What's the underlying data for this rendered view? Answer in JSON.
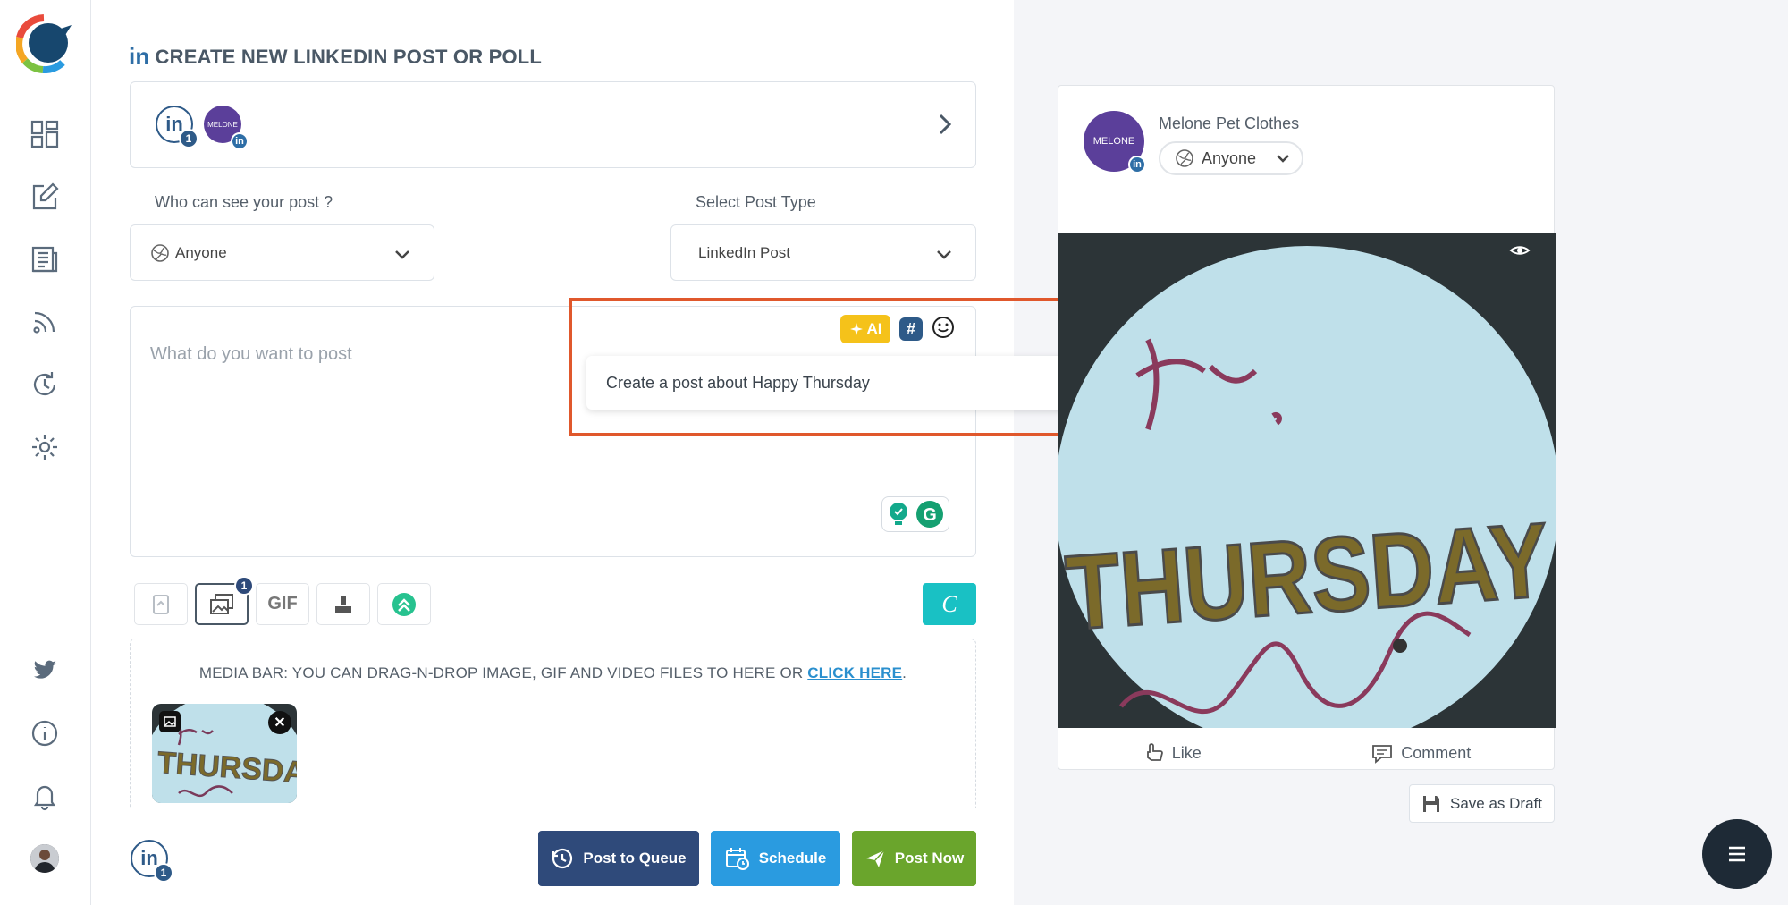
{
  "page": {
    "title": "CREATE NEW LINKEDIN POST OR POLL",
    "title_icon": "in"
  },
  "accounts": {
    "linkedin_label": "in",
    "linkedin_count": "1",
    "page_avatar_text": "MELONE",
    "page_badge": "in"
  },
  "visibility": {
    "label": "Who can see your post ?",
    "value": "Anyone"
  },
  "post_type": {
    "label": "Select Post Type",
    "value": "LinkedIn Post"
  },
  "editor": {
    "placeholder": "What do you want to post"
  },
  "ai_assist": {
    "ai_label": "AI",
    "hashtag_label": "#",
    "prompt_value": "Create a post about Happy Thursday",
    "enter_symbol": "↵"
  },
  "media_tools": {
    "gif_label": "GIF",
    "images_count": "1",
    "canva_label": "C"
  },
  "media_bar": {
    "text": "MEDIA BAR: YOU CAN DRAG-N-DROP IMAGE, GIF AND VIDEO FILES TO HERE OR ",
    "link": "CLICK HERE",
    "suffix": "."
  },
  "thumbnail": {
    "close": "✕"
  },
  "bottom": {
    "account_label": "in",
    "account_count": "1",
    "queue_label": "Post to Queue",
    "schedule_label": "Schedule",
    "post_now_label": "Post Now"
  },
  "preview": {
    "page_name": "Melone Pet Clothes",
    "avatar_text": "MELONE",
    "badge": "in",
    "visibility": "Anyone",
    "like_label": "Like",
    "comment_label": "Comment"
  },
  "save_draft_label": "Save as Draft",
  "colors": {
    "queue": "#2f4a7a",
    "schedule": "#2a9be0",
    "post_now": "#6aa52c",
    "highlight": "#e0582c",
    "ai_chip": "#f5c21a",
    "canva": "#19c1c4"
  }
}
